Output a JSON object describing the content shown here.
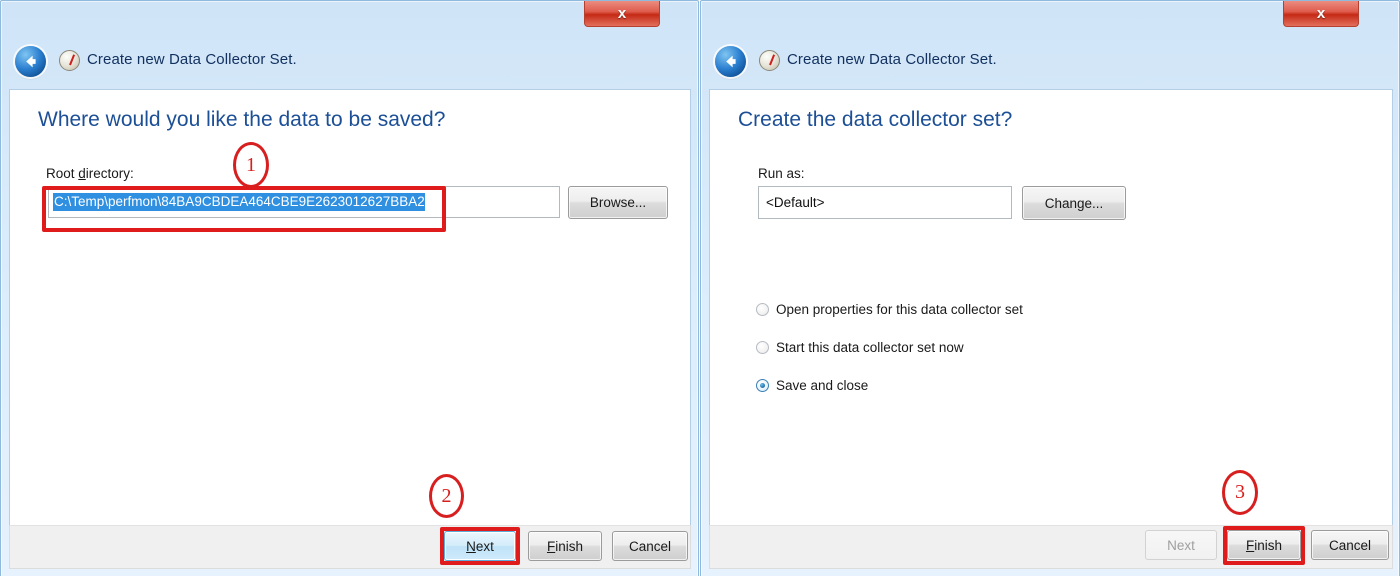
{
  "windows": [
    {
      "id": "left",
      "nav_title": "Create new Data Collector Set.",
      "close_label": "x",
      "heading": "Where would you like the data to be saved?",
      "root_directory_label_pre": "Root ",
      "root_directory_label_accel": "d",
      "root_directory_label_post": "irectory:",
      "root_directory_label": "Root directory:",
      "root_directory_value": "C:\\Temp\\perfmon\\84BA9CBDEA464CBE9E2623012627BBA2",
      "browse_button": "Browse...",
      "buttons": {
        "next": "Next",
        "next_accel": "N",
        "finish": "Finish",
        "finish_accel": "F",
        "cancel": "Cancel"
      }
    },
    {
      "id": "right",
      "nav_title": "Create new Data Collector Set.",
      "close_label": "x",
      "heading": "Create the data collector set?",
      "run_as_label": "Run as:",
      "run_as_value": "<Default>",
      "change_button": "Change...",
      "radio_options": [
        {
          "label": "Open properties for this data collector set",
          "selected": false
        },
        {
          "label": "Start this data collector set now",
          "selected": false
        },
        {
          "label": "Save and close",
          "selected": true
        }
      ],
      "buttons": {
        "next": "Next",
        "next_disabled": true,
        "finish": "Finish",
        "finish_accel": "F",
        "cancel": "Cancel"
      }
    }
  ],
  "annotations": [
    {
      "number": "1",
      "target": "root-directory-input"
    },
    {
      "number": "2",
      "target": "left-next-button"
    },
    {
      "number": "3",
      "target": "right-finish-button"
    }
  ],
  "colors": {
    "annotation_red": "#d81f1f",
    "heading_blue": "#1c4f96",
    "titlebar_blue": "#d8ebfb",
    "selection_blue": "#2f8fe0",
    "close_red": "#c52a16",
    "footer_gray": "#f0f0f0"
  }
}
